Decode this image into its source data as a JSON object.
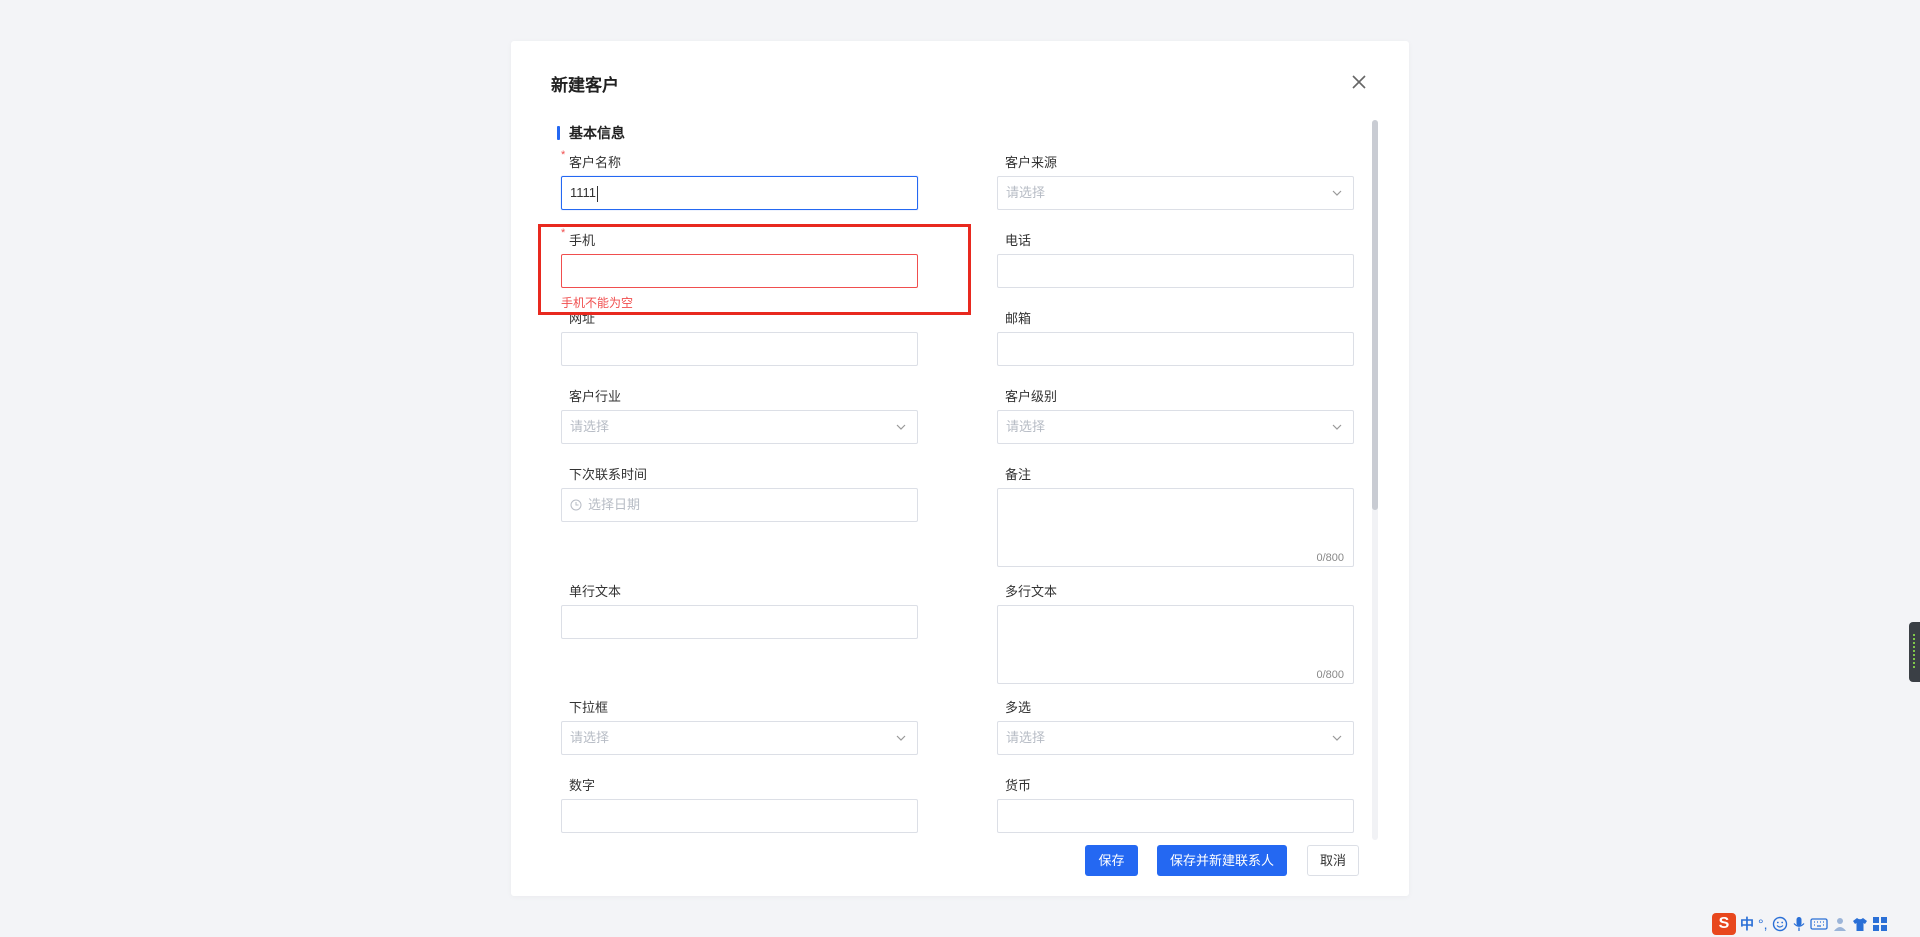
{
  "dialog": {
    "title": "新建客户",
    "section_title": "基本信息"
  },
  "fields": {
    "customer_name": {
      "label": "客户名称",
      "value": "1111"
    },
    "customer_source": {
      "label": "客户来源",
      "placeholder": "请选择"
    },
    "mobile": {
      "label": "手机",
      "value": "",
      "error": "手机不能为空"
    },
    "phone": {
      "label": "电话",
      "value": ""
    },
    "website": {
      "label": "网址",
      "value": ""
    },
    "email": {
      "label": "邮箱",
      "value": ""
    },
    "industry": {
      "label": "客户行业",
      "placeholder": "请选择"
    },
    "level": {
      "label": "客户级别",
      "placeholder": "请选择"
    },
    "next_contact": {
      "label": "下次联系时间",
      "placeholder": "选择日期"
    },
    "remark": {
      "label": "备注",
      "counter": "0/800"
    },
    "single_text": {
      "label": "单行文本",
      "value": ""
    },
    "multi_text": {
      "label": "多行文本",
      "counter": "0/800"
    },
    "dropdown": {
      "label": "下拉框",
      "placeholder": "请选择"
    },
    "multi_select": {
      "label": "多选",
      "placeholder": "请选择"
    },
    "number": {
      "label": "数字",
      "value": ""
    },
    "currency": {
      "label": "货币",
      "value": ""
    }
  },
  "required_marker": "*",
  "buttons": {
    "save": "保存",
    "save_and_new_contact": "保存并新建联系人",
    "cancel": "取消"
  },
  "ime": {
    "logo": "S",
    "mode": "中",
    "punct": "°,",
    "icons": [
      "smiley-icon",
      "microphone-icon",
      "keyboard-icon",
      "user-icon",
      "shirt-icon",
      "grid-icon"
    ]
  },
  "colors": {
    "accent": "#2468f2",
    "error": "#f04e4e",
    "highlight": "#e8291f"
  }
}
